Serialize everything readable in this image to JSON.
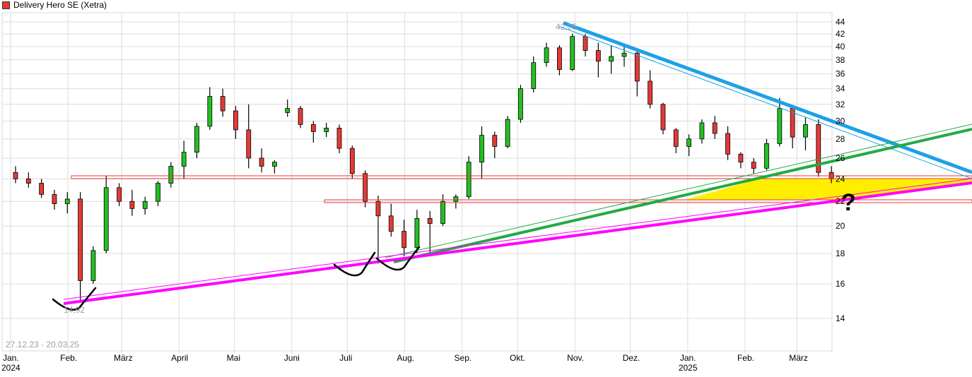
{
  "chart_data": {
    "type": "candlestick",
    "title": "Delivery Hero SE (Xetra)",
    "date_range_label": "27.12.23 - 20.03.25",
    "y_scale": "log",
    "ylim": [
      13,
      45
    ],
    "grid": true,
    "y_ticks": [
      14,
      16,
      18,
      20,
      22,
      24,
      26,
      28,
      30,
      32,
      34,
      36,
      38,
      40,
      42,
      44
    ],
    "x_ticks": [
      {
        "date": "2024-01-01",
        "label": "Jan.",
        "year": "2024"
      },
      {
        "date": "2024-02-01",
        "label": "Feb."
      },
      {
        "date": "2024-03-01",
        "label": "März"
      },
      {
        "date": "2024-04-01",
        "label": "April"
      },
      {
        "date": "2024-05-01",
        "label": "Mai"
      },
      {
        "date": "2024-06-01",
        "label": "Juni"
      },
      {
        "date": "2024-07-01",
        "label": "Juli"
      },
      {
        "date": "2024-08-01",
        "label": "Aug."
      },
      {
        "date": "2024-09-01",
        "label": "Sep."
      },
      {
        "date": "2024-10-01",
        "label": "Okt."
      },
      {
        "date": "2024-11-01",
        "label": "Nov."
      },
      {
        "date": "2024-12-01",
        "label": "Dez."
      },
      {
        "date": "2025-01-01",
        "label": "Jan.",
        "year": "2025"
      },
      {
        "date": "2025-02-01",
        "label": "Feb."
      },
      {
        "date": "2025-03-01",
        "label": "März"
      }
    ],
    "annotations": {
      "high_label": "42,05",
      "low_label": "14,92",
      "question_mark": "?",
      "resistance_level": 24.2,
      "support_level": 22.1
    },
    "colors": {
      "up": "#22c022",
      "down": "#e53935",
      "legend": "#e53935",
      "downtrend": "#1ea0e6",
      "uptrend_green": "#22aa44",
      "uptrend_magenta": "#ff00ff",
      "zone": "#ffee00",
      "level": "#e53935"
    },
    "candles": [
      [
        "2024-01-01",
        24.6,
        25.2,
        23.6,
        24.0
      ],
      [
        "2024-01-08",
        24.0,
        24.6,
        23.2,
        23.6
      ],
      [
        "2024-01-15",
        23.6,
        24.0,
        22.3,
        22.6
      ],
      [
        "2024-01-22",
        22.6,
        23.0,
        21.3,
        21.8
      ],
      [
        "2024-01-29",
        21.8,
        22.8,
        21.0,
        22.2
      ],
      [
        "2024-02-05",
        22.2,
        22.8,
        14.92,
        16.2
      ],
      [
        "2024-02-12",
        16.2,
        18.5,
        16.0,
        18.2
      ],
      [
        "2024-02-19",
        18.2,
        24.3,
        18.0,
        23.2
      ],
      [
        "2024-02-26",
        23.2,
        23.6,
        21.6,
        22.0
      ],
      [
        "2024-03-04",
        22.0,
        23.0,
        20.8,
        21.4
      ],
      [
        "2024-03-11",
        21.4,
        22.4,
        20.9,
        22.0
      ],
      [
        "2024-03-18",
        22.0,
        23.8,
        21.6,
        23.6
      ],
      [
        "2024-03-25",
        23.6,
        25.6,
        23.2,
        25.2
      ],
      [
        "2024-04-01",
        25.2,
        27.8,
        24.0,
        26.6
      ],
      [
        "2024-04-08",
        26.6,
        29.8,
        26.0,
        29.4
      ],
      [
        "2024-04-15",
        29.4,
        34.2,
        29.0,
        33.0
      ],
      [
        "2024-04-22",
        33.0,
        34.0,
        30.5,
        31.2
      ],
      [
        "2024-04-29",
        31.2,
        31.8,
        28.0,
        29.0
      ],
      [
        "2024-05-06",
        29.0,
        32.0,
        25.0,
        26.0
      ],
      [
        "2024-05-13",
        26.0,
        27.0,
        24.6,
        25.2
      ],
      [
        "2024-05-20",
        25.2,
        25.8,
        24.5,
        25.6
      ],
      [
        "2024-05-27",
        31.0,
        32.6,
        30.5,
        31.5
      ],
      [
        "2024-06-03",
        31.5,
        31.8,
        29.2,
        29.6
      ],
      [
        "2024-06-10",
        29.6,
        30.0,
        27.6,
        28.8
      ],
      [
        "2024-06-17",
        28.8,
        29.8,
        28.2,
        29.2
      ],
      [
        "2024-06-24",
        29.2,
        29.6,
        26.5,
        27.0
      ],
      [
        "2024-07-01",
        27.0,
        27.3,
        24.0,
        24.5
      ],
      [
        "2024-07-08",
        24.5,
        24.8,
        21.5,
        22.0
      ],
      [
        "2024-07-15",
        22.0,
        22.5,
        17.3,
        20.8
      ],
      [
        "2024-07-22",
        20.8,
        21.8,
        19.2,
        19.6
      ],
      [
        "2024-07-29",
        19.6,
        20.5,
        17.8,
        18.4
      ],
      [
        "2024-08-05",
        18.4,
        21.3,
        18.0,
        20.6
      ],
      [
        "2024-08-12",
        20.6,
        21.2,
        17.8,
        20.2
      ],
      [
        "2024-08-19",
        20.2,
        22.6,
        20.0,
        22.0
      ],
      [
        "2024-08-26",
        22.0,
        22.6,
        21.4,
        22.4
      ],
      [
        "2024-09-02",
        22.4,
        26.2,
        22.2,
        25.6
      ],
      [
        "2024-09-09",
        25.6,
        29.4,
        24.0,
        28.4
      ],
      [
        "2024-09-16",
        28.4,
        28.8,
        26.0,
        27.2
      ],
      [
        "2024-09-23",
        27.2,
        30.6,
        27.0,
        30.2
      ],
      [
        "2024-09-30",
        30.2,
        34.5,
        29.8,
        34.0
      ],
      [
        "2024-10-07",
        34.0,
        38.5,
        33.5,
        37.6
      ],
      [
        "2024-10-14",
        37.6,
        40.6,
        37.0,
        39.8
      ],
      [
        "2024-10-21",
        39.8,
        40.2,
        35.8,
        36.6
      ],
      [
        "2024-10-28",
        36.6,
        42.05,
        36.4,
        41.6
      ],
      [
        "2024-11-04",
        41.6,
        42.0,
        38.5,
        39.4
      ],
      [
        "2024-11-11",
        39.4,
        40.6,
        35.5,
        37.8
      ],
      [
        "2024-11-18",
        37.8,
        40.2,
        36.0,
        38.5
      ],
      [
        "2024-11-25",
        38.5,
        40.0,
        37.0,
        39.0
      ],
      [
        "2024-12-02",
        39.0,
        39.3,
        33.0,
        35.0
      ],
      [
        "2024-12-09",
        35.0,
        36.5,
        31.5,
        32.0
      ],
      [
        "2024-12-16",
        32.0,
        32.2,
        28.5,
        29.0
      ],
      [
        "2024-12-23",
        29.0,
        29.2,
        26.5,
        27.2
      ],
      [
        "2024-12-30",
        27.2,
        28.5,
        26.2,
        28.0
      ],
      [
        "2025-01-06",
        28.0,
        30.2,
        27.5,
        29.8
      ],
      [
        "2025-01-13",
        29.8,
        30.6,
        28.0,
        28.6
      ],
      [
        "2025-01-20",
        28.6,
        29.4,
        25.8,
        26.4
      ],
      [
        "2025-01-27",
        26.4,
        26.6,
        25.0,
        25.6
      ],
      [
        "2025-02-03",
        25.6,
        26.0,
        24.5,
        25.0
      ],
      [
        "2025-02-10",
        25.0,
        28.0,
        24.8,
        27.5
      ],
      [
        "2025-02-17",
        27.5,
        32.8,
        27.2,
        31.5
      ],
      [
        "2025-02-24",
        31.5,
        31.8,
        27.0,
        28.2
      ],
      [
        "2025-03-03",
        28.2,
        30.4,
        26.8,
        29.6
      ],
      [
        "2025-03-10",
        29.6,
        30.2,
        24.2,
        24.6
      ],
      [
        "2025-03-17",
        24.6,
        25.2,
        23.6,
        24.0
      ]
    ]
  }
}
